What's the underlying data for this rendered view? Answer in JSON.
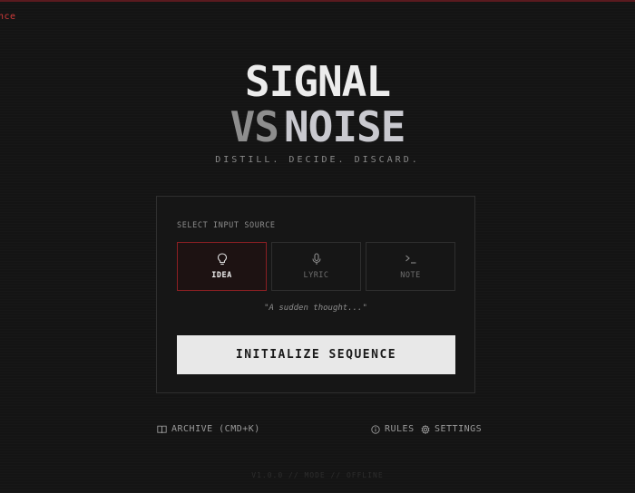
{
  "corner": {
    "text": "nce"
  },
  "title": {
    "line1": "SIGNAL",
    "vs": "VS",
    "noise": "NOISE"
  },
  "tagline": "DISTILL. DECIDE. DISCARD.",
  "panel": {
    "source_label": "SELECT INPUT SOURCE",
    "options": [
      {
        "label": "IDEA",
        "icon": "lightbulb-icon",
        "active": true
      },
      {
        "label": "LYRIC",
        "icon": "microphone-icon",
        "active": false
      },
      {
        "label": "NOTE",
        "icon": "terminal-icon",
        "active": false
      }
    ],
    "hint": "\"A sudden thought...\"",
    "init_button": "INITIALIZE SEQUENCE"
  },
  "footer": {
    "archive": "ARCHIVE (CMD+K)",
    "rules": "RULES",
    "settings": "SETTINGS"
  },
  "version": "V1.0.0 // MODE // OFFLINE",
  "colors": {
    "accent": "#8b1f23",
    "corner": "#d23a3a",
    "background": "#141414"
  }
}
